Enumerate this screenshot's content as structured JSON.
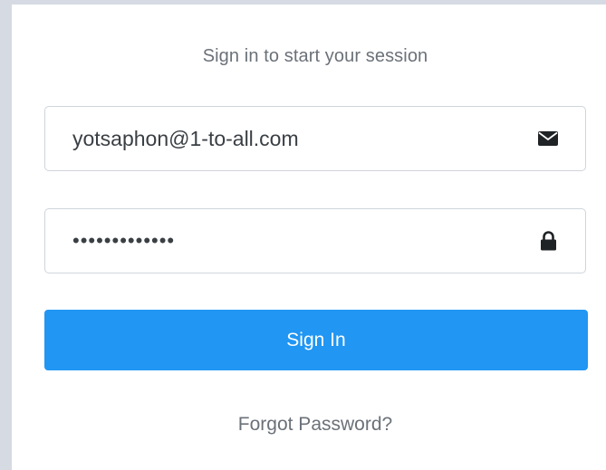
{
  "login": {
    "subtitle": "Sign in to start your session",
    "email_value": "yotsaphon@1-to-all.com",
    "email_icon": "envelope-icon",
    "password_value": "yotsaphon1234",
    "password_icon": "lock-icon",
    "signin_label": "Sign In",
    "forgot_label": "Forgot Password?"
  },
  "colors": {
    "primary_button": "#2196f3",
    "background": "#d6dbe3",
    "muted_text": "#6b7178"
  }
}
